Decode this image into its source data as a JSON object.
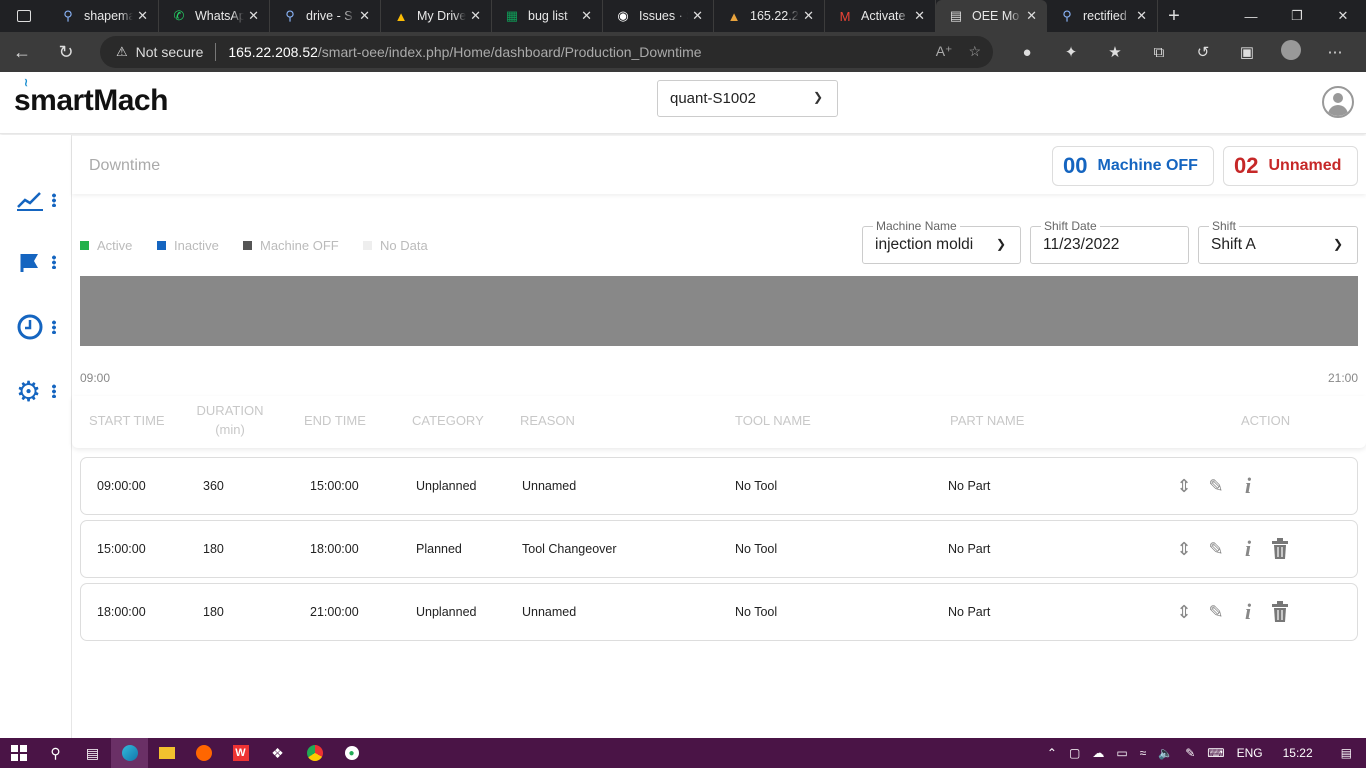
{
  "browser": {
    "tabs": [
      {
        "label": "shapema",
        "icon": "search-icon"
      },
      {
        "label": "WhatsAp",
        "icon": "whatsapp-icon"
      },
      {
        "label": "drive - S",
        "icon": "search-icon"
      },
      {
        "label": "My Drive",
        "icon": "drive-icon"
      },
      {
        "label": "bug list",
        "icon": "sheets-icon"
      },
      {
        "label": "Issues · S",
        "icon": "github-icon"
      },
      {
        "label": "165.22.2",
        "icon": "site-icon"
      },
      {
        "label": "Activate",
        "icon": "gmail-icon"
      },
      {
        "label": "OEE Mo",
        "icon": "page-icon"
      },
      {
        "label": "rectified",
        "icon": "search-icon"
      }
    ],
    "security_label": "Not secure",
    "url_host": "165.22.208.52",
    "url_path": "/smart-oee/index.php/Home/dashboard/Production_Downtime"
  },
  "app": {
    "logo_text": "smartMach",
    "machine_selector": "quant-S1002",
    "page_title": "Downtime",
    "machine_off": {
      "count": "00",
      "label": "Machine OFF",
      "color": "#1565c0"
    },
    "unnamed": {
      "count": "02",
      "label": "Unnamed",
      "color": "#c62828"
    }
  },
  "legend": [
    {
      "label": "Active",
      "color": "#22b14c"
    },
    {
      "label": "Inactive",
      "color": "#1565c0"
    },
    {
      "label": "Machine OFF",
      "color": "#555555"
    },
    {
      "label": "No Data",
      "color": "#eeeeee"
    }
  ],
  "filters": {
    "machine_name": {
      "label": "Machine Name",
      "value": "injection moldi"
    },
    "shift_date": {
      "label": "Shift Date",
      "value": "11/23/2022"
    },
    "shift": {
      "label": "Shift",
      "value": "Shift A"
    }
  },
  "timeline": {
    "start": "09:00",
    "end": "21:00",
    "color": "#888888"
  },
  "table": {
    "headers": {
      "start_time": "START TIME",
      "duration": "DURATION",
      "duration_unit": "(min)",
      "end_time": "END TIME",
      "category": "CATEGORY",
      "reason": "REASON",
      "tool_name": "TOOL NAME",
      "part_name": "PART NAME",
      "action": "ACTION"
    },
    "rows": [
      {
        "start": "09:00:00",
        "duration": "360",
        "end": "15:00:00",
        "category": "Unplanned",
        "reason": "Unnamed",
        "tool": "No Tool",
        "part": "No Part",
        "deletable": false
      },
      {
        "start": "15:00:00",
        "duration": "180",
        "end": "18:00:00",
        "category": "Planned",
        "reason": "Tool Changeover",
        "tool": "No Tool",
        "part": "No Part",
        "deletable": true
      },
      {
        "start": "18:00:00",
        "duration": "180",
        "end": "21:00:00",
        "category": "Unplanned",
        "reason": "Unnamed",
        "tool": "No Tool",
        "part": "No Part",
        "deletable": true
      }
    ]
  },
  "taskbar": {
    "language": "ENG",
    "time": "15:22"
  }
}
